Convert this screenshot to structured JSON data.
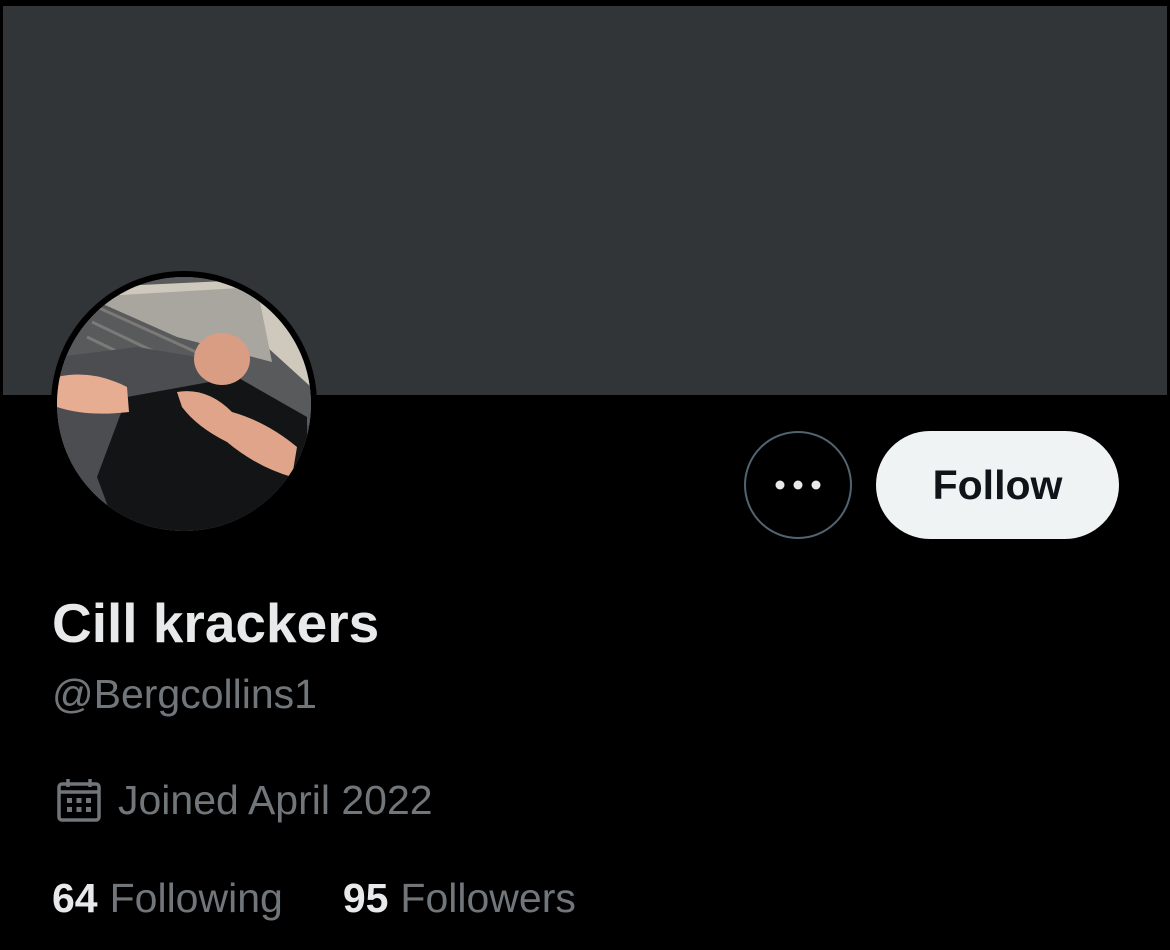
{
  "profile": {
    "display_name": "Cill krackers",
    "handle": "@Bergcollins1",
    "joined": "Joined April 2022",
    "avatar_icon": "profile-photo",
    "calendar_icon": "calendar-icon"
  },
  "actions": {
    "more_icon": "more-icon",
    "follow_label": "Follow"
  },
  "stats": {
    "following_count": "64",
    "following_label": "Following",
    "followers_count": "95",
    "followers_label": "Followers"
  },
  "colors": {
    "background": "#000000",
    "banner": "#323538",
    "primary_text": "#e7e9ea",
    "secondary_text": "#71767b",
    "follow_button_bg": "#eff3f4",
    "follow_button_text": "#0f1419",
    "outline": "#536471"
  }
}
